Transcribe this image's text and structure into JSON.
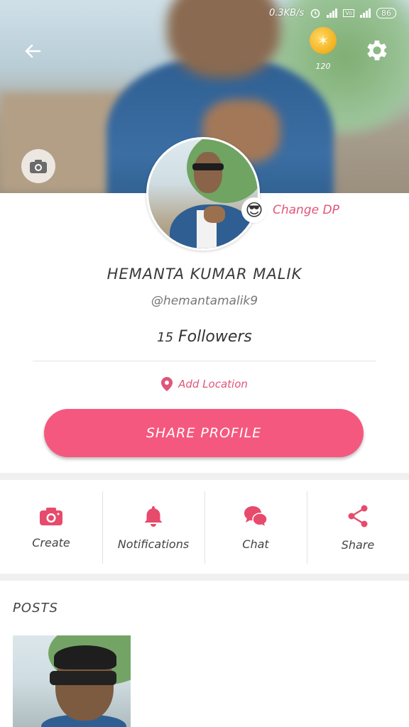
{
  "status_bar": {
    "speed": "0.3KB/s",
    "battery": "86",
    "volte": "Vo"
  },
  "header": {
    "coins": "120",
    "back_icon": "back-arrow-icon",
    "coin_icon": "coin-icon",
    "settings_icon": "gear-icon",
    "camera_icon": "camera-icon"
  },
  "profile": {
    "change_dp_emoji": "😎",
    "change_dp_label": "Change DP",
    "name": "HEMANTA KUMAR MALIK",
    "handle": "@hemantamalik9",
    "followers_count": "15",
    "followers_label": "Followers",
    "location_label": "Add Location"
  },
  "share_profile_label": "SHARE PROFILE",
  "actions": [
    {
      "label": "Create",
      "icon": "camera-icon"
    },
    {
      "label": "Notifications",
      "icon": "bell-icon"
    },
    {
      "label": "Chat",
      "icon": "chat-bubbles-icon"
    },
    {
      "label": "Share",
      "icon": "share-icon"
    }
  ],
  "posts": {
    "title": "POSTS"
  },
  "colors": {
    "accent": "#f5587e",
    "accent_text": "#e0557a",
    "coin": "#f2b01e"
  }
}
